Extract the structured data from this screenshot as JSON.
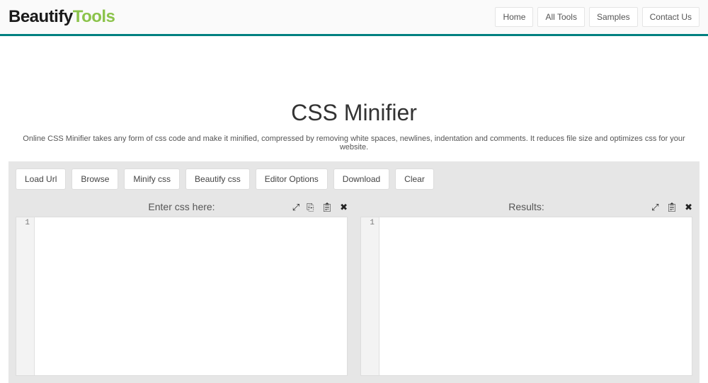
{
  "logo": {
    "left": "Beautify",
    "right": "Tools"
  },
  "nav": {
    "home": "Home",
    "all_tools": "All Tools",
    "samples": "Samples",
    "contact": "Contact Us"
  },
  "page": {
    "title": "CSS Minifier",
    "description": "Online CSS Minifier takes any form of css code and make it minified, compressed by removing white spaces, newlines, indentation and comments. It reduces file size and optimizes css for your website."
  },
  "toolbar": {
    "load_url": "Load Url",
    "browse": "Browse",
    "minify": "Minify css",
    "beautify": "Beautify css",
    "editor_options": "Editor Options",
    "download": "Download",
    "clear": "Clear"
  },
  "panels": {
    "input": {
      "title": "Enter css here:",
      "line": "1"
    },
    "output": {
      "title": "Results:",
      "line": "1"
    }
  }
}
